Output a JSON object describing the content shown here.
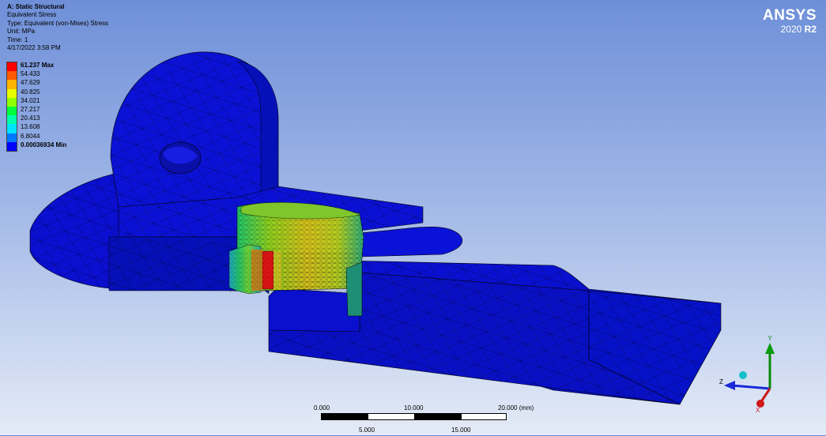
{
  "info": {
    "title": "A: Static Structural",
    "result": "Equivalent Stress",
    "type": "Type: Equivalent (von-Mises) Stress",
    "unit": "Unit: MPa",
    "time": "Time: 1",
    "date": "4/17/2022 3:58 PM"
  },
  "legend": {
    "labels": [
      "61.237 Max",
      "54.433",
      "47.629",
      "40.825",
      "34.021",
      "27.217",
      "20.413",
      "13.608",
      "6.8044",
      "0.00036934 Min"
    ],
    "colors": [
      "#ff0000",
      "#ff5a00",
      "#ffb400",
      "#e8ff00",
      "#90ff00",
      "#00ff3c",
      "#00ffaa",
      "#00e4ff",
      "#0078ff",
      "#0000ff"
    ]
  },
  "logo": {
    "brand": "ANSYS",
    "year": "2020",
    "release": "R2"
  },
  "scale": {
    "top_labels": [
      "0.000",
      "10.000",
      "20.000 (mm)"
    ],
    "bottom_labels": [
      "5.000",
      "15.000"
    ]
  },
  "triad": {
    "y": "Y",
    "z": "Z",
    "x": "X"
  }
}
